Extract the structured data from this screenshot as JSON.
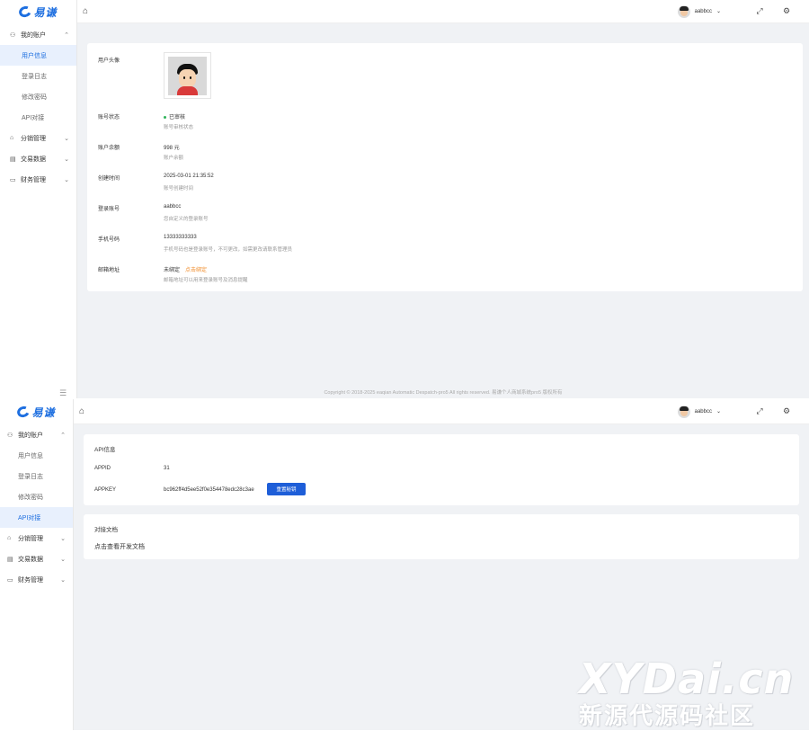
{
  "brand": {
    "logo_text": "易谦",
    "accent": "#1e6fe0"
  },
  "header": {
    "username": "aabbcc"
  },
  "sidebar": {
    "groups": [
      {
        "label": "我的账户",
        "icon": "user-icon",
        "items": [
          "用户信息",
          "登录日志",
          "修改密码",
          "API对接"
        ]
      },
      {
        "label": "分销管理",
        "icon": "bag-icon"
      },
      {
        "label": "交易数据",
        "icon": "keyboard-icon"
      },
      {
        "label": "财务管理",
        "icon": "folder-icon"
      }
    ]
  },
  "profile": {
    "avatar_label": "用户头像",
    "status_label": "账号状态",
    "status_value": "已审核",
    "status_desc": "账号审核状态",
    "balance_label": "账户余额",
    "balance_value": "998 元",
    "balance_desc": "账户余额",
    "created_label": "创建时间",
    "created_value": "2025-03-01 21:35:52",
    "created_desc": "账号创建时间",
    "login_label": "登录账号",
    "login_value": "aabbcc",
    "login_desc": "您自定义的登录账号",
    "phone_label": "手机号码",
    "phone_value": "13333333333",
    "phone_desc": "手机号码也是登录账号，不可更改，如需更改请联系管理员",
    "email_label": "邮箱地址",
    "email_value": "未绑定",
    "email_link": "点击绑定",
    "email_desc": "邮箱地址可以用来登录账号及消息提醒"
  },
  "footer": {
    "text": "Copyright © 2018-2025 eaqian Automatic Despatch-pro5 All rights reserved. 易谦个人商城系统pro5 版权所有"
  },
  "api": {
    "title": "API信息",
    "appid_label": "APPID",
    "appid_value": "31",
    "appkey_label": "APPKEY",
    "appkey_value": "bc962ff4d5ee52f0e354478edc28c3ae",
    "reset_label": "重置秘钥"
  },
  "docs": {
    "title": "对接文档",
    "link": "点击查看开发文档"
  },
  "watermark": {
    "line1": "XYDai.cn",
    "line2": "新源代源码社区"
  }
}
